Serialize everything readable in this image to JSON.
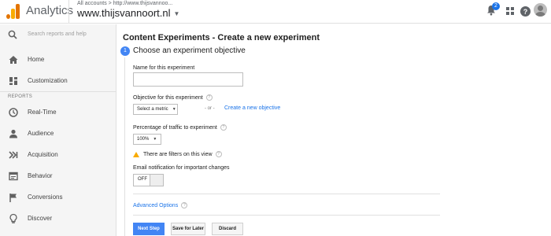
{
  "header": {
    "app_name": "Analytics",
    "breadcrumb": "All accounts > http://www.thijsvannoo...",
    "property": "www.thijsvannoort.nl",
    "notification_count": "2"
  },
  "sidebar": {
    "search_placeholder": "Search reports and help",
    "items_top": [
      {
        "label": "Home",
        "icon": "home-icon"
      },
      {
        "label": "Customization",
        "icon": "dashboard-icon"
      }
    ],
    "section_label": "REPORTS",
    "items_reports": [
      {
        "label": "Real-Time",
        "icon": "clock-icon"
      },
      {
        "label": "Audience",
        "icon": "person-icon"
      },
      {
        "label": "Acquisition",
        "icon": "acquisition-icon"
      },
      {
        "label": "Behavior",
        "icon": "behavior-icon"
      },
      {
        "label": "Conversions",
        "icon": "flag-icon"
      },
      {
        "label": "Discover",
        "icon": "lightbulb-icon"
      }
    ]
  },
  "main": {
    "title": "Content Experiments - Create a new experiment",
    "step_number": "1",
    "step_title": "Choose an experiment objective",
    "name_label": "Name for this experiment",
    "name_value": "",
    "objective_label": "Objective for this experiment",
    "objective_select": "Select a metric",
    "or_text": "- or -",
    "create_objective_link": "Create a new objective",
    "traffic_label": "Percentage of traffic to experiment",
    "traffic_value": "100%",
    "filters_warning": "There are filters on this view",
    "email_label": "Email notification for important changes",
    "email_toggle": "OFF",
    "advanced_options": "Advanced Options",
    "buttons": {
      "next": "Next Step",
      "save_later": "Save for Later",
      "discard": "Discard"
    }
  },
  "colors": {
    "accent": "#4285f4",
    "link": "#1a73e8",
    "sidebar_bg": "#f5f5f5",
    "warning": "#f9ab00"
  }
}
